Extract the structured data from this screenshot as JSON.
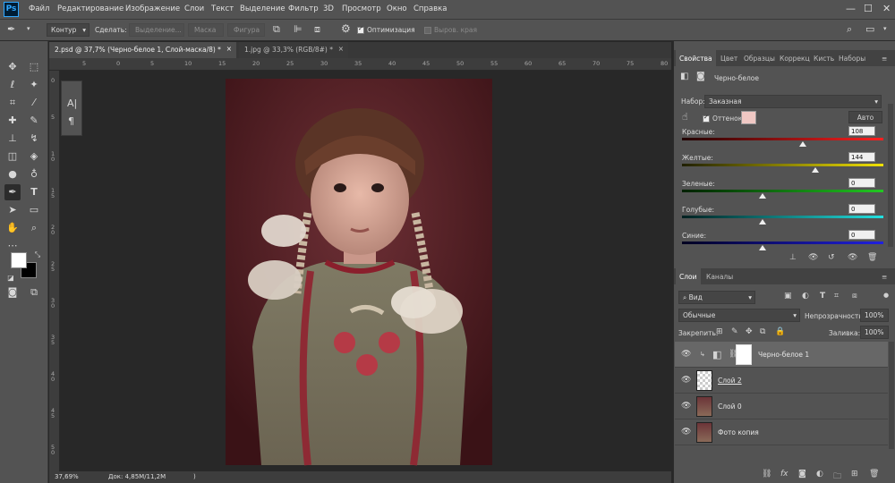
{
  "app": {
    "logo": "Ps"
  },
  "menu": [
    "Файл",
    "Редактирование",
    "Изображение",
    "Слои",
    "Текст",
    "Выделение",
    "Фильтр",
    "3D",
    "Просмотр",
    "Окно",
    "Справка"
  ],
  "window_controls": [
    "—",
    "☐",
    "✕"
  ],
  "options": {
    "mode": "Контур",
    "make_label": "Сделать:",
    "btn_selection": "Выделение...",
    "btn_mask": "Маска",
    "btn_shape": "Фигура",
    "optimization": "Оптимизация",
    "align_edges": "Выров. края"
  },
  "tabs": [
    {
      "label": "2.psd @ 37,7% (Черно-белое 1, Слой-маска/8) *",
      "close": "×"
    },
    {
      "label": "1.jpg @ 33,3% (RGB/8#) *",
      "close": "×"
    }
  ],
  "ruler_h": [
    "5",
    "0",
    "5",
    "10",
    "15",
    "20",
    "25",
    "30",
    "35",
    "40",
    "45",
    "50",
    "55",
    "60",
    "65",
    "70",
    "75",
    "80"
  ],
  "ruler_v": [
    "0",
    "5",
    "1 0",
    "1 5",
    "2 0",
    "2 5",
    "3 0",
    "3 5",
    "4 0",
    "4 5",
    "5 0"
  ],
  "status": {
    "zoom": "37,69%",
    "doc": "Док: 4,85M/11,2M"
  },
  "properties": {
    "tabs": [
      "Свойства",
      "Цвет",
      "Образцы",
      "Коррекц",
      "Кисть",
      "Наборы"
    ],
    "title": "Черно-белое",
    "preset_label": "Набор:",
    "preset_value": "Заказная",
    "tint_label": "Оттенок",
    "tint_color": "#f0c8c4",
    "auto_label": "Авто",
    "sliders": [
      {
        "label": "Красные:",
        "value": "108",
        "grad": "linear-gradient(to right,#200000,#ff2020)",
        "level": 0.6
      },
      {
        "label": "Желтые:",
        "value": "144",
        "grad": "linear-gradient(to right,#202000,#f2e200)",
        "level": 0.66
      },
      {
        "label": "Зеленые:",
        "value": "0",
        "grad": "linear-gradient(to right,#002000,#22c822)",
        "level": 0.4
      },
      {
        "label": "Голубые:",
        "value": "0",
        "grad": "linear-gradient(to right,#002020,#22e0e0)",
        "level": 0.4
      },
      {
        "label": "Синие:",
        "value": "0",
        "grad": "linear-gradient(to right,#000020,#2020e0)",
        "level": 0.4
      }
    ]
  },
  "layers": {
    "tabs": [
      "Слои",
      "Каналы"
    ],
    "filter": "Вид",
    "blend": "Обычные",
    "opacity_label": "Непрозрачность:",
    "opacity": "100%",
    "lock_label": "Закрепить:",
    "fill_label": "Заливка:",
    "fill": "100%",
    "items": [
      {
        "name": "Черно-белое 1",
        "type": "adjustment",
        "selected": true
      },
      {
        "name": "Слой 2",
        "type": "transparent",
        "selected": false
      },
      {
        "name": "Слой 0",
        "type": "photo",
        "selected": false
      },
      {
        "name": "Фото копия",
        "type": "photo",
        "selected": false
      }
    ]
  }
}
